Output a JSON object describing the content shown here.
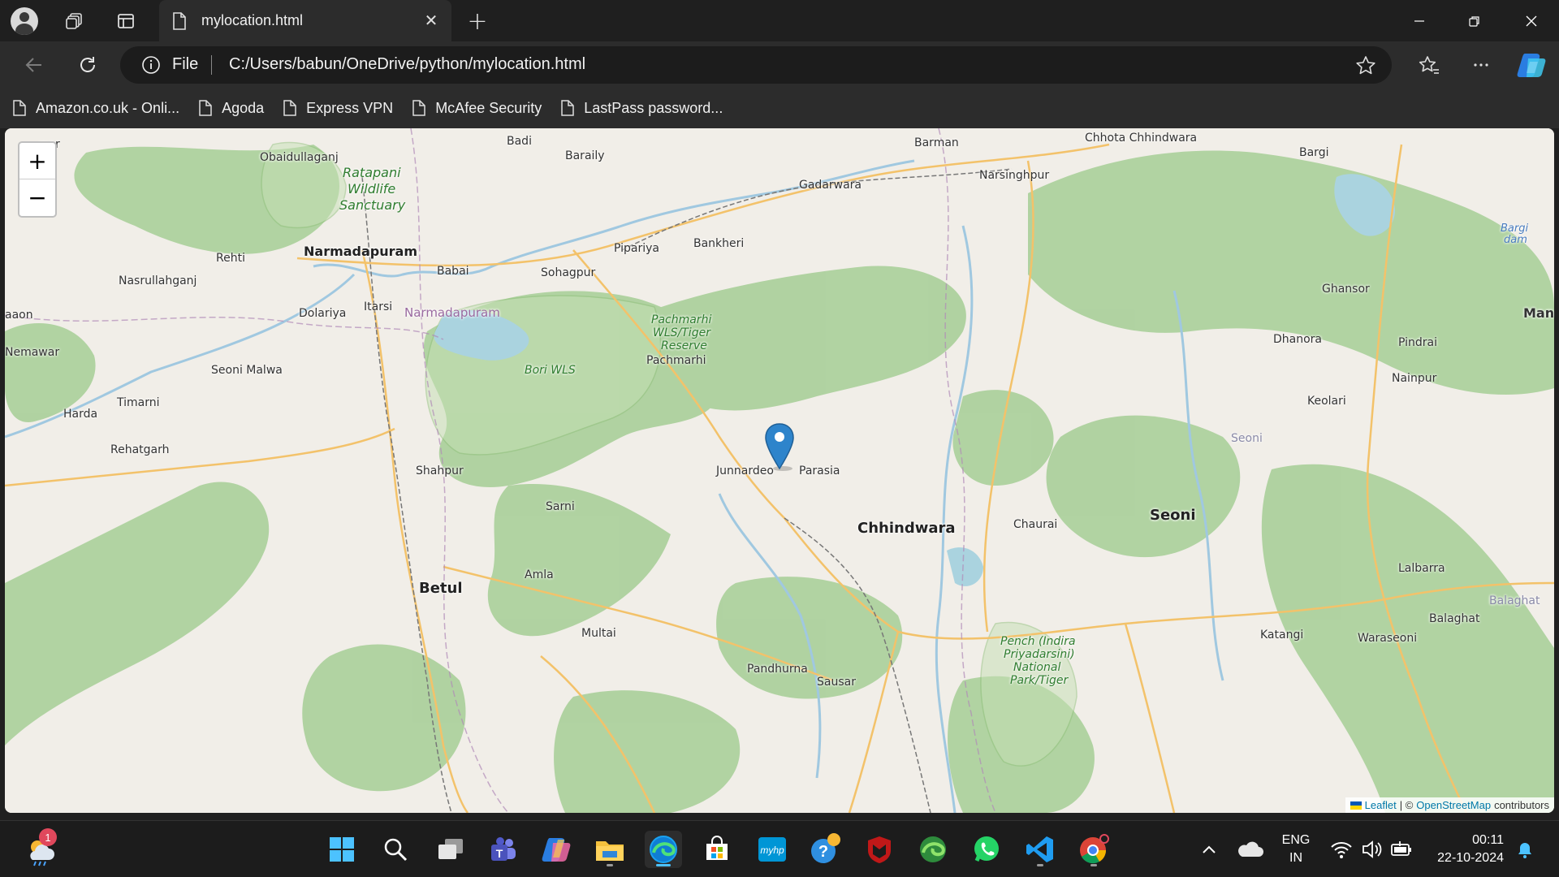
{
  "browser": {
    "tab_title": "mylocation.html",
    "scheme_label": "File",
    "url": "C:/Users/babun/OneDrive/python/mylocation.html",
    "icons": [
      "profile-avatar-icon",
      "workspaces-icon",
      "tab-actions-icon",
      "page-icon",
      "close-icon",
      "plus-icon",
      "minimize-icon",
      "restore-icon",
      "close-window-icon",
      "back-arrow-icon",
      "reload-icon",
      "info-icon",
      "star-icon",
      "favorites-icon",
      "more-icon",
      "copilot-icon"
    ],
    "bookmarks": [
      {
        "label": "Amazon.co.uk - Onli..."
      },
      {
        "label": "Agoda"
      },
      {
        "label": "Express VPN"
      },
      {
        "label": "McAfee Security"
      },
      {
        "label": "LastPass password..."
      }
    ]
  },
  "map": {
    "zoom_in": "+",
    "zoom_out": "−",
    "attribution": {
      "leaflet": "Leaflet",
      "separator": "| ©",
      "osm": "OpenStreetMap",
      "suffix": "contributors"
    },
    "places": {
      "war": "war",
      "badi": "Badi",
      "baraily": "Baraily",
      "barman": "Barman",
      "chhota_chhindwara": "Chhota Chhindwara",
      "bargi": "Bargi",
      "obaidullaganj": "Obaidullaganj",
      "gadarwara": "Gadarwara",
      "narsinghpur": "Narsinghpur",
      "pipariya": "Pipariya",
      "bankheri": "Bankheri",
      "rehti": "Rehti",
      "narmadapuram": "Narmadapuram",
      "babai": "Babai",
      "sohagpur": "Sohagpur",
      "nasrullahganj": "Nasrullahganj",
      "ghansor": "Ghansor",
      "aaon": "aaon",
      "dolariya": "Dolariya",
      "itarsi": "Itarsi",
      "narmadapuram_district": "Narmadapuram",
      "mandla": "Mandl",
      "dhanora": "Dhanora",
      "pindrai": "Pindrai",
      "nemawar": "Nemawar",
      "seoni_malwa": "Seoni Malwa",
      "pachmarhi": "Pachmarhi",
      "nainpur": "Nainpur",
      "timarni": "Timarni",
      "keolari": "Keolari",
      "harda": "Harda",
      "seoni_district": "Seoni",
      "rehatgarh": "Rehatgarh",
      "shahpur": "Shahpur",
      "junnardeo": "Junnardeo",
      "parasia": "Parasia",
      "sarni": "Sarni",
      "seoni": "Seoni",
      "chhindwara": "Chhindwara",
      "chaurai": "Chaurai",
      "lalbarra": "Lalbarra",
      "amla": "Amla",
      "betul": "Betul",
      "balaghat_district": "Balaghat",
      "balaghat": "Balaghat",
      "multai": "Multai",
      "katangi": "Katangi",
      "waraseoni": "Waraseoni",
      "pandhurna": "Pandhurna",
      "sausar": "Sausar"
    },
    "parks": {
      "ratapani_1": "Ratapani",
      "ratapani_2": "Wildlife",
      "ratapani_3": "Sanctuary",
      "pachmarhi_1": "Pachmarhi",
      "pachmarhi_2": "WLS/Tiger",
      "pachmarhi_3": "Reserve",
      "bori": "Bori WLS",
      "pench_1": "Pench (Indira",
      "pench_2": "Priyadarsini)",
      "pench_3": "National",
      "pench_4": "Park/Tiger"
    },
    "water": {
      "bargi_1": "Bargi",
      "bargi_2": "dam"
    }
  },
  "taskbar": {
    "weather_badge": "1",
    "apps": [
      "start-icon",
      "search-icon",
      "task-view-icon",
      "teams-icon",
      "copilot-icon",
      "file-explorer-icon",
      "edge-icon",
      "store-icon",
      "myhp-icon",
      "help-icon",
      "mcafee-icon",
      "edge-dev-icon",
      "whatsapp-icon",
      "vscode-icon",
      "chrome-icon"
    ],
    "lang_1": "ENG",
    "lang_2": "IN",
    "time": "00:11",
    "date": "22-10-2024"
  }
}
